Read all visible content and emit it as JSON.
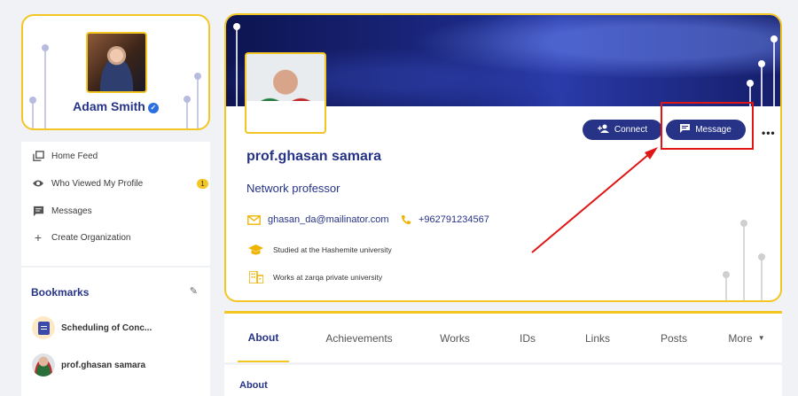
{
  "me": {
    "name": "Adam Smith",
    "verified_icon": "verified-check-icon"
  },
  "nav": {
    "items": [
      {
        "label": "Home Feed",
        "icon": "home-feed-icon"
      },
      {
        "label": "Who Viewed My Profile",
        "icon": "eye-icon",
        "badge": "1"
      },
      {
        "label": "Messages",
        "icon": "message-icon"
      },
      {
        "label": "Create Organization",
        "icon": "plus-icon"
      }
    ]
  },
  "bookmarks": {
    "title": "Bookmarks",
    "items": [
      {
        "label": "Scheduling of Conc...",
        "icon": "document-icon"
      },
      {
        "label": "prof.ghasan samara",
        "icon": "avatar"
      }
    ]
  },
  "profile": {
    "name": "prof.ghasan samara",
    "title": "Network professor",
    "email": "ghasan_da@mailinator.com",
    "phone": "+962791234567",
    "education": "Studied at the Hashemite university",
    "work": "Works at zarqa private university",
    "connect_label": "Connect",
    "message_label": "Message"
  },
  "tabs": [
    "About",
    "Achievements",
    "Works",
    "IDs",
    "Links",
    "Posts",
    "More"
  ],
  "about": {
    "title": "About"
  },
  "colors": {
    "brand": "#263387",
    "accent": "#f3c623",
    "highlight": "#e01515"
  }
}
